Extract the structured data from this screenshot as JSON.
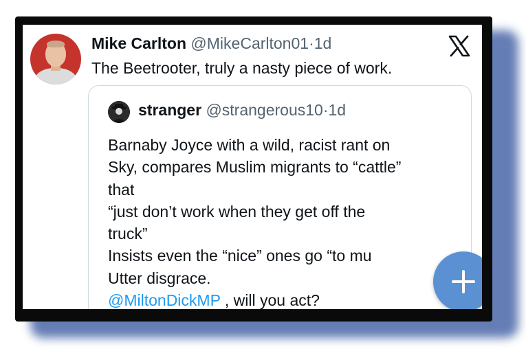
{
  "tweet": {
    "author_name": "Mike Carlton",
    "handle": "@MikeCarlton01",
    "separator": "·",
    "time": "1d",
    "text": "The Beetrooter, truly a nasty piece of work."
  },
  "quoted_tweet": {
    "author_name": "stranger",
    "handle": "@strangerous10",
    "separator": "·",
    "time": "1d",
    "lines": [
      "Barnaby Joyce with a wild, racist rant on",
      "Sky, compares Muslim migrants to “cattle”",
      "that",
      "“just don’t work when they get off the",
      "truck”",
      "Insists even the “nice” ones go “to mu"
    ],
    "line7": "Utter disgrace.",
    "mention": "@MiltonDickMP",
    "last_text": " , will you act?"
  },
  "icons": {
    "brand": "x-logo-icon",
    "compose": "plus-icon"
  },
  "colors": {
    "mention": "#1d9bf0",
    "fab": "#5b91d3",
    "muted": "#536471"
  }
}
